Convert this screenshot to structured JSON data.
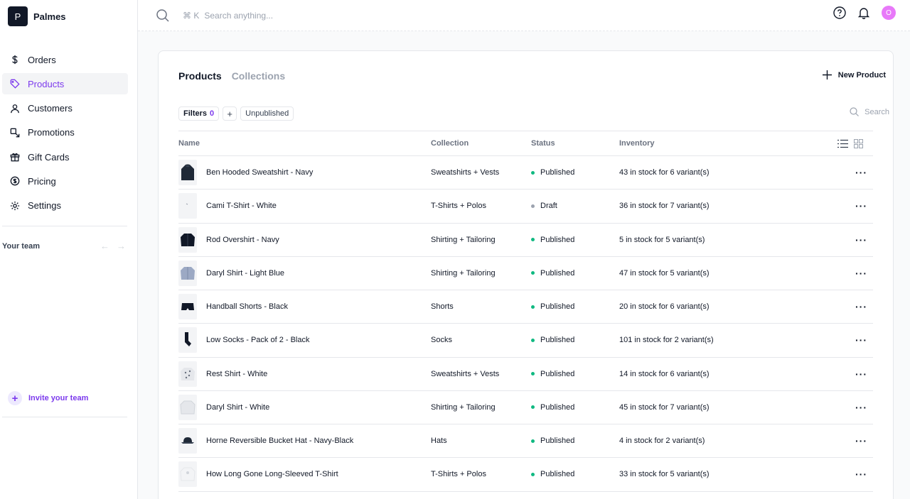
{
  "brand": {
    "letter": "P",
    "name": "Palmes"
  },
  "nav": [
    {
      "label": "Orders",
      "icon": "dollar-icon"
    },
    {
      "label": "Products",
      "icon": "tag-icon",
      "active": true
    },
    {
      "label": "Customers",
      "icon": "user-icon"
    },
    {
      "label": "Promotions",
      "icon": "promotion-icon"
    },
    {
      "label": "Gift Cards",
      "icon": "gift-icon"
    },
    {
      "label": "Pricing",
      "icon": "coin-icon"
    },
    {
      "label": "Settings",
      "icon": "gear-icon"
    }
  ],
  "team": {
    "label": "Your team",
    "invite": "Invite your team"
  },
  "topbar": {
    "shortcut": "⌘ K",
    "search_placeholder": "Search anything...",
    "avatar_letter": "O"
  },
  "page": {
    "tabs": [
      "Products",
      "Collections"
    ],
    "new_product": "New Product",
    "filters_label": "Filters",
    "filters_count": "0",
    "filter_chip": "Unpublished",
    "search_placeholder": "Search"
  },
  "table": {
    "headers": [
      "Name",
      "Collection",
      "Status",
      "Inventory"
    ],
    "rows": [
      {
        "name": "Ben Hooded Sweatshirt - Navy",
        "collection": "Sweatshirts + Vests",
        "status": "Published",
        "inventory": "43 in stock for 6 variant(s)"
      },
      {
        "name": "Cami T-Shirt - White",
        "collection": "T-Shirts + Polos",
        "status": "Draft",
        "inventory": "36 in stock for 7 variant(s)"
      },
      {
        "name": "Rod Overshirt - Navy",
        "collection": "Shirting + Tailoring",
        "status": "Published",
        "inventory": "5 in stock for 5 variant(s)"
      },
      {
        "name": "Daryl Shirt - Light Blue",
        "collection": "Shirting + Tailoring",
        "status": "Published",
        "inventory": "47 in stock for 5 variant(s)"
      },
      {
        "name": "Handball Shorts - Black",
        "collection": "Shorts",
        "status": "Published",
        "inventory": "20 in stock for 6 variant(s)"
      },
      {
        "name": "Low Socks - Pack of 2 - Black",
        "collection": "Socks",
        "status": "Published",
        "inventory": "101 in stock for 2 variant(s)"
      },
      {
        "name": "Rest Shirt - White",
        "collection": "Sweatshirts + Vests",
        "status": "Published",
        "inventory": "14 in stock for 6 variant(s)"
      },
      {
        "name": "Daryl Shirt - White",
        "collection": "Shirting + Tailoring",
        "status": "Published",
        "inventory": "45 in stock for 7 variant(s)"
      },
      {
        "name": "Horne Reversible Bucket Hat - Navy-Black",
        "collection": "Hats",
        "status": "Published",
        "inventory": "4 in stock for 2 variant(s)"
      },
      {
        "name": "How Long Gone Long-Sleeved T-Shirt",
        "collection": "T-Shirts + Polos",
        "status": "Published",
        "inventory": "33 in stock for 5 variant(s)"
      }
    ]
  },
  "colors": {
    "accent": "#7c3aed",
    "published": "#10b981",
    "draft": "#9ca3af"
  }
}
